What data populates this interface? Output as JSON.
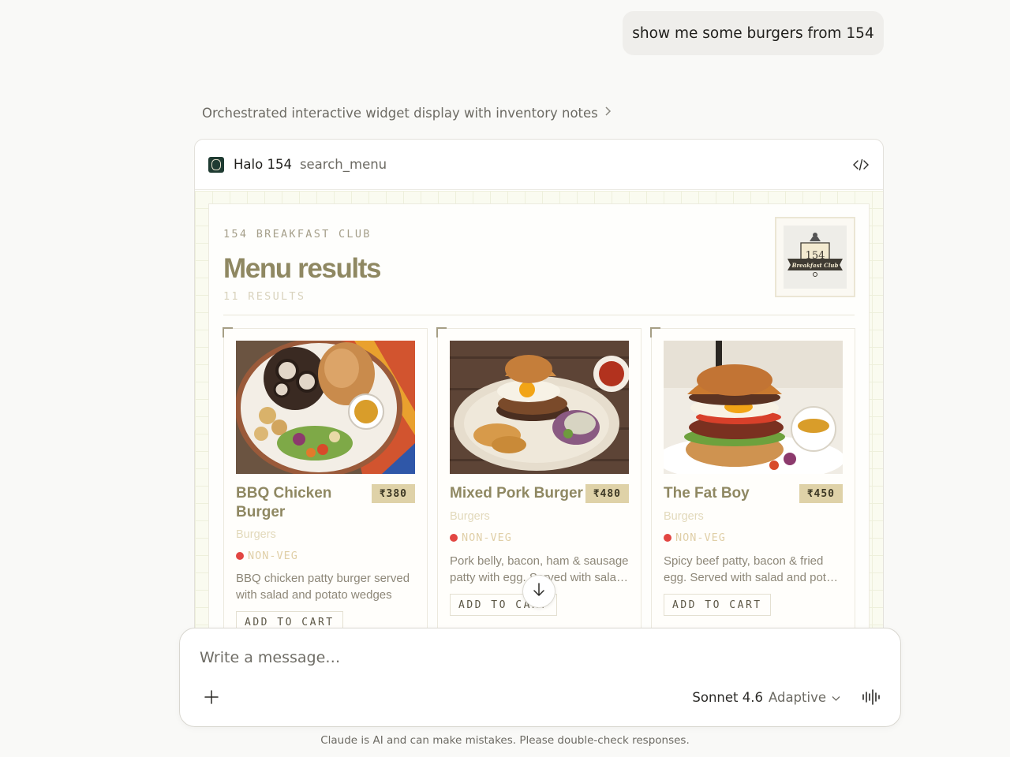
{
  "user_message": "show me some burgers from 154",
  "orchestration_note": "Orchestrated interactive widget display with inventory notes",
  "widget": {
    "app_name": "Halo 154",
    "tool_name": "search_menu",
    "icons": {
      "app": "halo-logo-icon",
      "code": "code-icon"
    }
  },
  "menu": {
    "club_label": "154 BREAKFAST CLUB",
    "title": "Menu results",
    "results_count": "11 RESULTS",
    "brand_logo": {
      "number": "154",
      "subtitle": "Breakfast Club"
    },
    "items": [
      {
        "name": "BBQ Chicken Burger",
        "price": "₹380",
        "category": "Burgers",
        "diet": "NON-VEG",
        "description": "BBQ chicken patty burger served with salad and potato wedges",
        "cart_label": "ADD TO CART"
      },
      {
        "name": "Mixed Pork Burger",
        "price": "₹480",
        "category": "Burgers",
        "diet": "NON-VEG",
        "description": "Pork belly, bacon, ham & sausage patty with egg. Served with salad and potato wedges",
        "cart_label": "ADD TO CART"
      },
      {
        "name": "The Fat Boy",
        "price": "₹450",
        "category": "Burgers",
        "diet": "NON-VEG",
        "description": "Spicy beef patty, bacon & fried egg. Served with salad and potato wedges",
        "cart_label": "ADD TO CART"
      }
    ],
    "colors": {
      "non_veg_dot": "#e24642",
      "price_bg": "#dfd2a8",
      "title": "#8f8862"
    }
  },
  "composer": {
    "placeholder": "Write a message…",
    "model_name": "Sonnet 4.6",
    "model_mode": "Adaptive",
    "icons": {
      "plus": "plus-icon",
      "chevron": "chevron-down-icon",
      "voice": "voice-waveform-icon",
      "scroll": "arrow-down-icon"
    }
  },
  "disclaimer": "Claude is AI and can make mistakes. Please double-check responses."
}
